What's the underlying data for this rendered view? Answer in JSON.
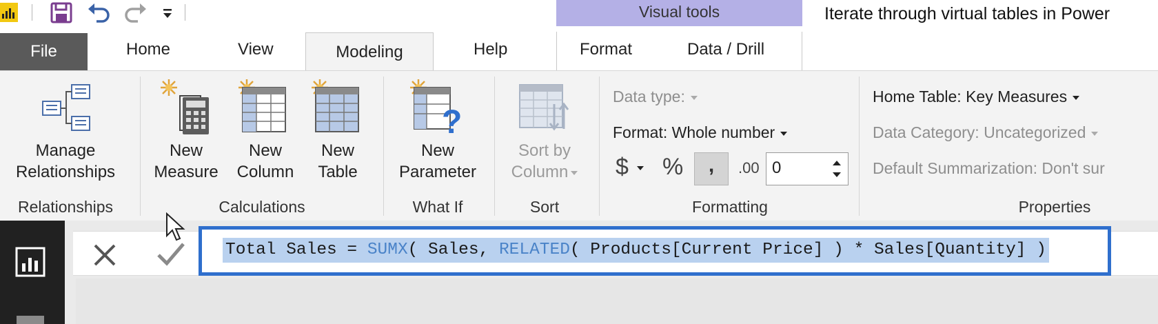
{
  "window": {
    "title": "Iterate through virtual tables in Power"
  },
  "quick_access": {
    "items": [
      "powerbi-logo-icon",
      "save-icon",
      "undo-icon",
      "redo-icon",
      "customize-caret-icon"
    ]
  },
  "contextual_band": {
    "label": "Visual tools"
  },
  "tabs": {
    "file": "File",
    "home": "Home",
    "view": "View",
    "modeling": "Modeling",
    "help": "Help",
    "format": "Format",
    "data_drill": "Data / Drill",
    "active": "Modeling"
  },
  "ribbon": {
    "relationships": {
      "manage_line1": "Manage",
      "manage_line2": "Relationships",
      "group_label": "Relationships"
    },
    "calculations": {
      "new_measure_line1": "New",
      "new_measure_line2": "Measure",
      "new_column_line1": "New",
      "new_column_line2": "Column",
      "new_table_line1": "New",
      "new_table_line2": "Table",
      "group_label": "Calculations"
    },
    "what_if": {
      "new_param_line1": "New",
      "new_param_line2": "Parameter",
      "group_label": "What If"
    },
    "sort": {
      "sort_line1": "Sort by",
      "sort_line2": "Column",
      "group_label": "Sort"
    },
    "formatting": {
      "data_type": "Data type:",
      "format": "Format: Whole number",
      "currency_symbol": "$",
      "percent_symbol": "%",
      "comma_symbol": ",",
      "decimal_icon_text": ".00",
      "decimal_places": "0",
      "group_label": "Formatting"
    },
    "properties": {
      "home_table": "Home Table: Key Measures",
      "data_category": "Data Category: Uncategorized",
      "default_summarization": "Default Summarization: Don't sur",
      "group_label": "Properties"
    }
  },
  "formula_bar": {
    "measure_name": "Total Sales = ",
    "fn1": "SUMX",
    "part2": "( Sales, ",
    "fn2": "RELATED",
    "part3": "( Products[Current Price] ) * Sales[Quantity] )"
  },
  "colors": {
    "file_tab": "#5a5a5a",
    "visual_tools": "#b4b0e6",
    "formula_highlight": "#2f6fcd",
    "function_blue": "#4a83c8",
    "selection": "#b9d1ef",
    "left_rail": "#212121"
  }
}
